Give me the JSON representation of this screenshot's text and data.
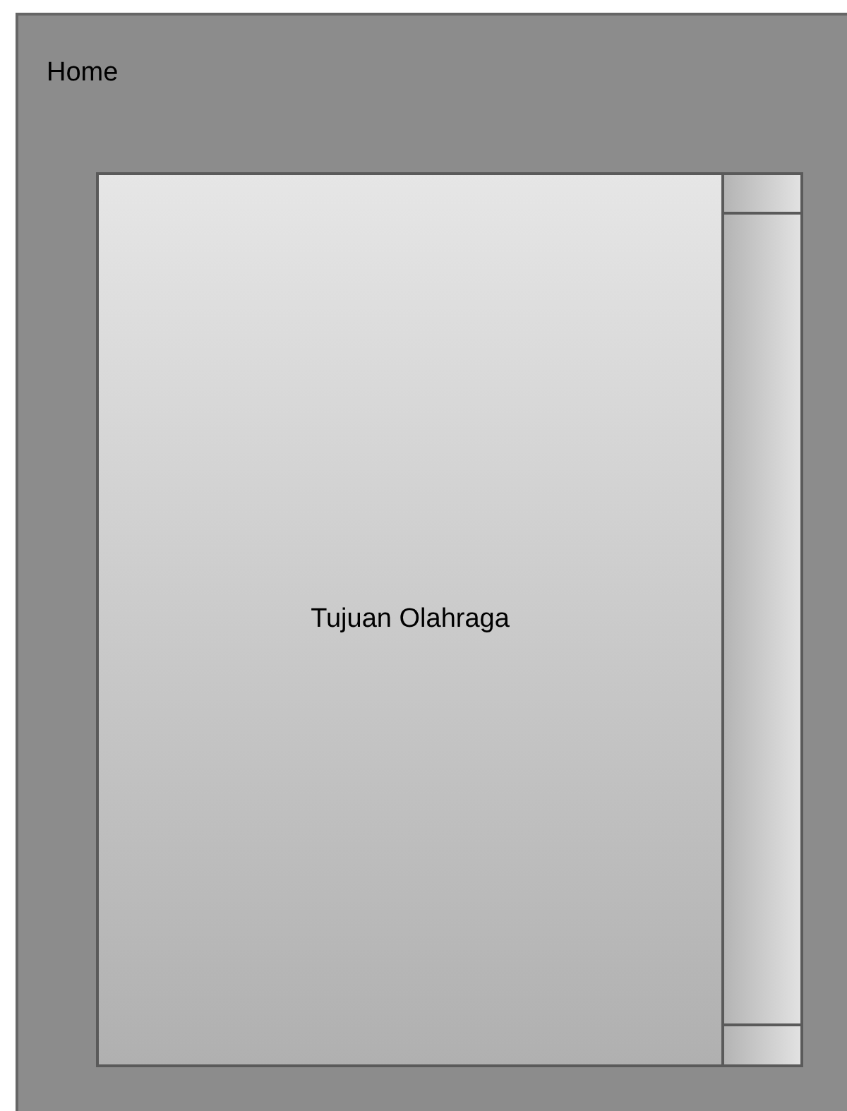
{
  "page": {
    "title": "Home"
  },
  "card": {
    "label": "Tujuan Olahraga"
  }
}
